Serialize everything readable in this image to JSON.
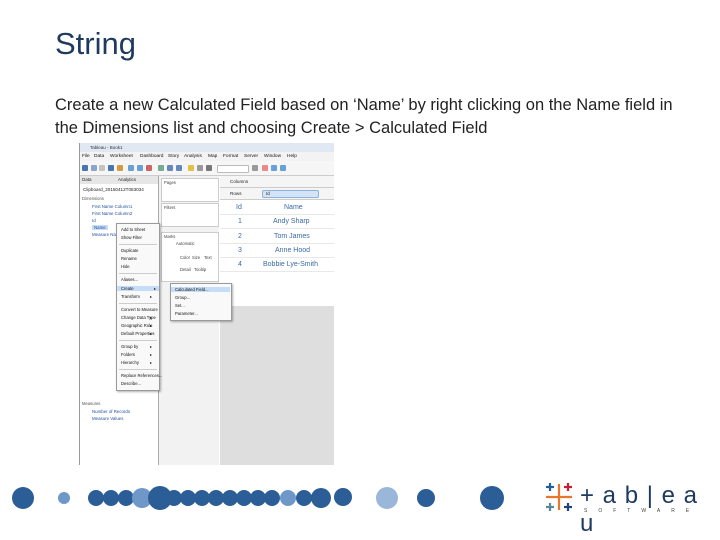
{
  "slide": {
    "title": "String",
    "body": "Create a new Calculated Field based on ‘Name’ by right clicking on the Name field in the Dimensions list and choosing Create > Calculated Field"
  },
  "screenshot": {
    "window_title": "Tableau - Book1",
    "menus": [
      "File",
      "Data",
      "Worksheet",
      "Dashboard",
      "Story",
      "Analysis",
      "Map",
      "Format",
      "Server",
      "Window",
      "Help"
    ],
    "pane_tabs": [
      "Data",
      "Analytics"
    ],
    "connection": "Clipboard_20150412T083034",
    "dimensions_header": "Dimensions",
    "fields": [
      "First Name Column1",
      "First Name Column2",
      "Id",
      "Name",
      "Measure Names"
    ],
    "measures_header": "Measures",
    "measure_fields": [
      "Number of Records",
      "Measure Values"
    ],
    "shelves": {
      "pages": "Pages",
      "filters": "Filters",
      "marks": "Marks",
      "automatic": "Automatic"
    },
    "mark_buttons": [
      "Color",
      "Size",
      "Text",
      "Detail",
      "Tooltip"
    ],
    "columns_label": "Columns",
    "rows_label": "Rows",
    "rows_pill": "Id",
    "table": {
      "headers": [
        "Id",
        "Name"
      ],
      "rows": [
        [
          "1",
          "Andy Sharp"
        ],
        [
          "2",
          "Tom James"
        ],
        [
          "3",
          "Anne Hood"
        ],
        [
          "4",
          "Bobbie Lye-Smith"
        ]
      ]
    },
    "context_menu": [
      "Add to Sheet",
      "Show Filter",
      "Duplicate",
      "Rename",
      "Hide",
      "Aliases...",
      "Create",
      "Transform",
      "Convert to Measure",
      "Change Data Type",
      "Geographic Role",
      "Default Properties",
      "Group by",
      "Folders",
      "Hierarchy",
      "Replace References...",
      "Describe..."
    ],
    "create_submenu": [
      "Calculated Field...",
      "Group...",
      "Set...",
      "Parameter..."
    ]
  },
  "logo": {
    "word": "+ a b | e a u",
    "sub": "SOFTWARE"
  },
  "colors": {
    "title": "#1f3a5f",
    "dots": "#2b5d96",
    "dots_light": "#9ab6d8",
    "highlight": "#c5ddf6"
  }
}
